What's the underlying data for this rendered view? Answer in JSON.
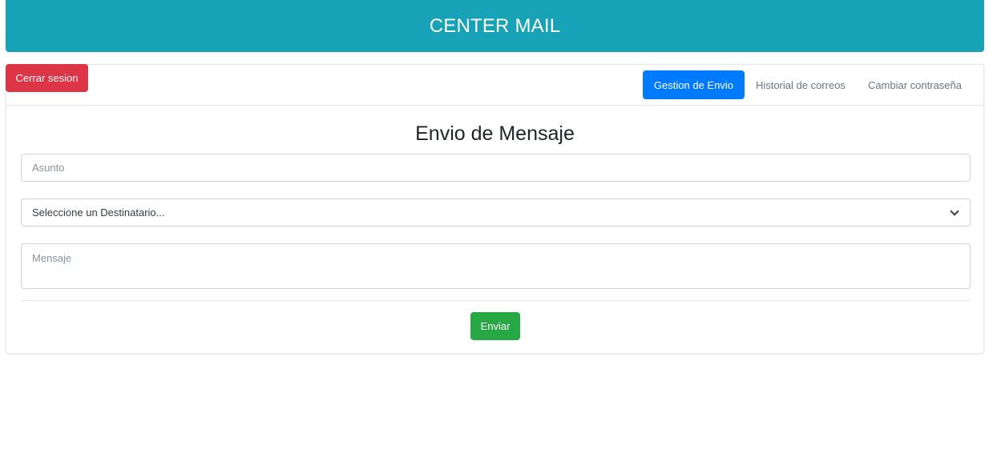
{
  "header": {
    "title": "CENTER MAIL",
    "color": "#17a2b8"
  },
  "toolbar": {
    "logout_label": "Cerrar sesion"
  },
  "nav": {
    "items": [
      {
        "label": "Gestion de Envio",
        "active": true
      },
      {
        "label": "Historial de correos",
        "active": false
      },
      {
        "label": "Cambiar contraseña",
        "active": false
      }
    ]
  },
  "form": {
    "title": "Envio de Mensaje",
    "subject": {
      "value": "",
      "placeholder": "Asunto"
    },
    "recipient": {
      "selected": "Seleccione un Destinatario..."
    },
    "message": {
      "value": "",
      "placeholder": "Mensaje"
    },
    "submit_label": "Enviar"
  },
  "colors": {
    "primary": "#007bff",
    "danger": "#dc3545",
    "success": "#28a745"
  },
  "icons": {
    "select_arrow": "chevron-down-icon"
  }
}
